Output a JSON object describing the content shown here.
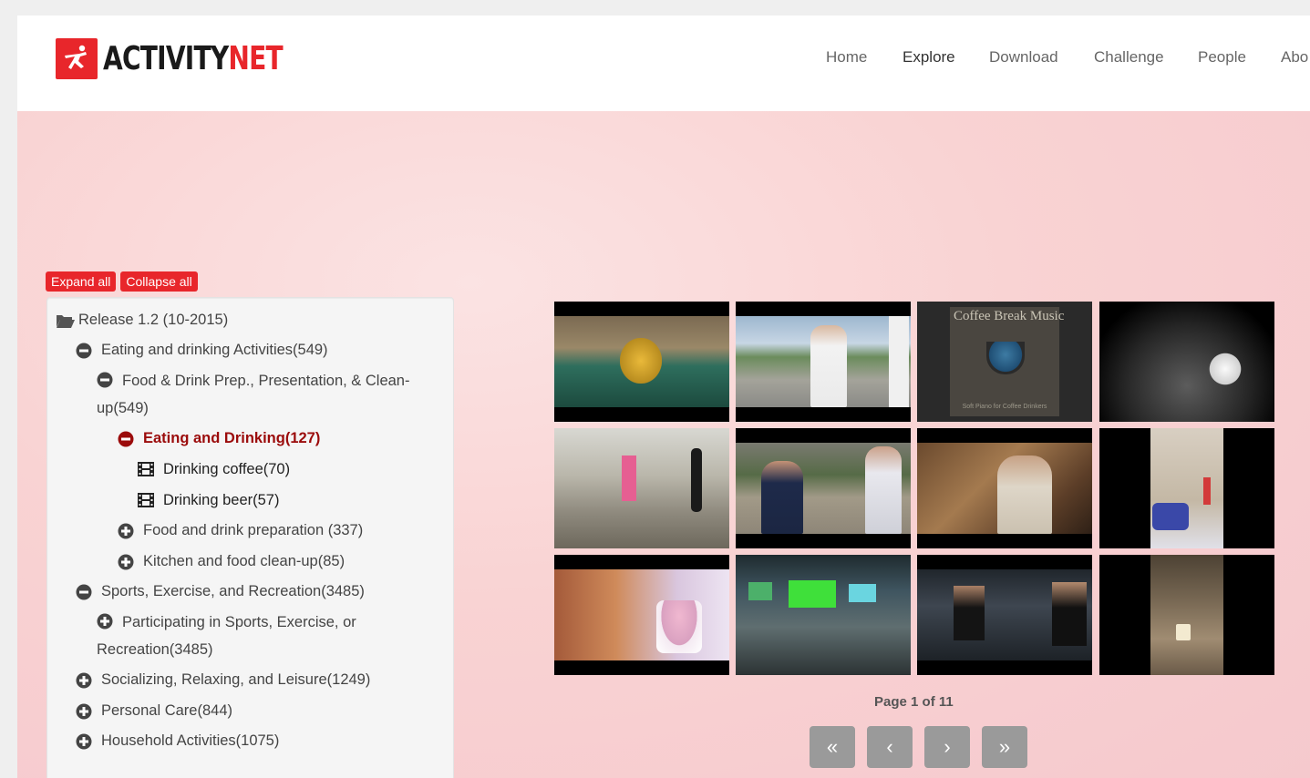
{
  "brand": {
    "name_part1": "ACTIVITY",
    "name_part2": "NET",
    "red": "#e8262b"
  },
  "nav": [
    {
      "label": "Home",
      "active": false
    },
    {
      "label": "Explore",
      "active": true
    },
    {
      "label": "Download",
      "active": false
    },
    {
      "label": "Challenge",
      "active": false
    },
    {
      "label": "People",
      "active": false
    },
    {
      "label": "Abo",
      "active": false
    }
  ],
  "tree_controls": {
    "expand_label": "Expand all",
    "collapse_label": "Collapse all"
  },
  "tree": {
    "root": "Release 1.2 (10-2015)",
    "nodes": [
      {
        "label": "Eating and drinking Activities(549)",
        "icon": "minus-circle-icon"
      },
      {
        "label": "Food & Drink Prep., Presentation, & Clean-up(549)",
        "icon": "minus-circle-icon"
      },
      {
        "label": "Eating and Drinking(127)",
        "icon": "minus-circle-icon",
        "selected": true
      },
      {
        "label": "Drinking coffee(70)",
        "icon": "film-icon"
      },
      {
        "label": "Drinking beer(57)",
        "icon": "film-icon"
      },
      {
        "label": "Food and drink preparation (337)",
        "icon": "plus-circle-icon"
      },
      {
        "label": "Kitchen and food clean-up(85)",
        "icon": "plus-circle-icon"
      },
      {
        "label": "Sports, Exercise, and Recreation(3485)",
        "icon": "minus-circle-icon"
      },
      {
        "label": "Participating in Sports, Exercise, or Recreation(3485)",
        "icon": "plus-circle-icon"
      },
      {
        "label": "Socializing, Relaxing, and Leisure(1249)",
        "icon": "plus-circle-icon"
      },
      {
        "label": "Personal Care(844)",
        "icon": "plus-circle-icon"
      },
      {
        "label": "Household Activities(1075)",
        "icon": "plus-circle-icon"
      }
    ]
  },
  "videos": {
    "thumbnail_text": {
      "coffee_title": "Coffee Break Music",
      "coffee_caption": "Soft Piano for Coffee Drinkers"
    }
  },
  "pager": {
    "label": "Page 1 of 11",
    "first": "«",
    "prev": "‹",
    "next": "›",
    "last": "»"
  }
}
